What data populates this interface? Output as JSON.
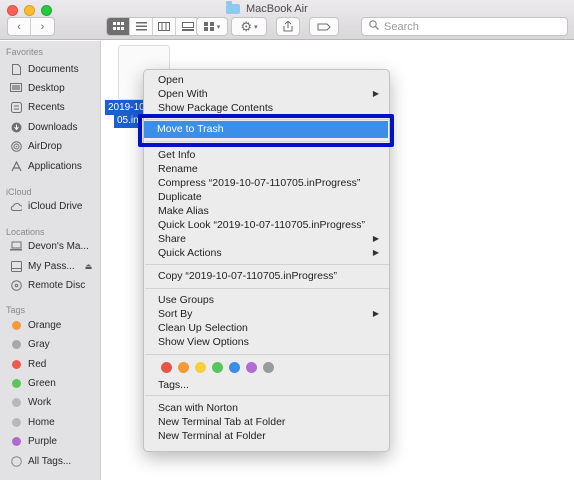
{
  "window": {
    "title": "MacBook Air"
  },
  "toolbar": {
    "search_placeholder": "Search",
    "view_buttons": [
      "icon-view",
      "list-view",
      "column-view",
      "gallery-view"
    ]
  },
  "sidebar": {
    "favorites_header": "Favorites",
    "favorites": [
      {
        "label": "Documents",
        "icon": "document-icon"
      },
      {
        "label": "Desktop",
        "icon": "desktop-icon"
      },
      {
        "label": "Recents",
        "icon": "clock-icon"
      },
      {
        "label": "Downloads",
        "icon": "download-icon"
      },
      {
        "label": "AirDrop",
        "icon": "airdrop-icon"
      },
      {
        "label": "Applications",
        "icon": "applications-icon"
      }
    ],
    "icloud_header": "iCloud",
    "icloud": [
      {
        "label": "iCloud Drive",
        "icon": "cloud-icon"
      }
    ],
    "locations_header": "Locations",
    "locations": [
      {
        "label": "Devon's Ma...",
        "icon": "laptop-icon"
      },
      {
        "label": "My Pass...",
        "icon": "drive-icon"
      },
      {
        "label": "Remote Disc",
        "icon": "disc-icon"
      }
    ],
    "tags_header": "Tags",
    "tags": [
      {
        "label": "Orange",
        "color": "#f49a3a"
      },
      {
        "label": "Gray",
        "color": "#a7a7a7"
      },
      {
        "label": "Red",
        "color": "#ee5a4f"
      },
      {
        "label": "Green",
        "color": "#5ec45a"
      },
      {
        "label": "Work",
        "color": "#b8b8b8"
      },
      {
        "label": "Home",
        "color": "#b8b8b8"
      },
      {
        "label": "Purple",
        "color": "#b26ad0"
      },
      {
        "label": "All Tags...",
        "color": ""
      }
    ]
  },
  "file": {
    "label_line1": "2019-10-",
    "label_line2": "05.in"
  },
  "context_menu": {
    "open": "Open",
    "open_with": "Open With",
    "show_package_contents": "Show Package Contents",
    "move_to_trash": "Move to Trash",
    "get_info": "Get Info",
    "rename": "Rename",
    "compress": "Compress “2019-10-07-110705.inProgress”",
    "duplicate": "Duplicate",
    "make_alias": "Make Alias",
    "quick_look": "Quick Look “2019-10-07-110705.inProgress”",
    "share": "Share",
    "quick_actions": "Quick Actions",
    "copy": "Copy “2019-10-07-110705.inProgress”",
    "use_groups": "Use Groups",
    "sort_by": "Sort By",
    "clean_up_selection": "Clean Up Selection",
    "show_view_options": "Show View Options",
    "tag_colors": [
      "#e9544c",
      "#f29a38",
      "#f6cf3f",
      "#5ac45d",
      "#3a8ee8",
      "#b16bd3",
      "#9a9a9a"
    ],
    "tags": "Tags...",
    "scan_with_norton": "Scan with Norton",
    "new_terminal_tab": "New Terminal Tab at Folder",
    "new_terminal": "New Terminal at Folder"
  }
}
